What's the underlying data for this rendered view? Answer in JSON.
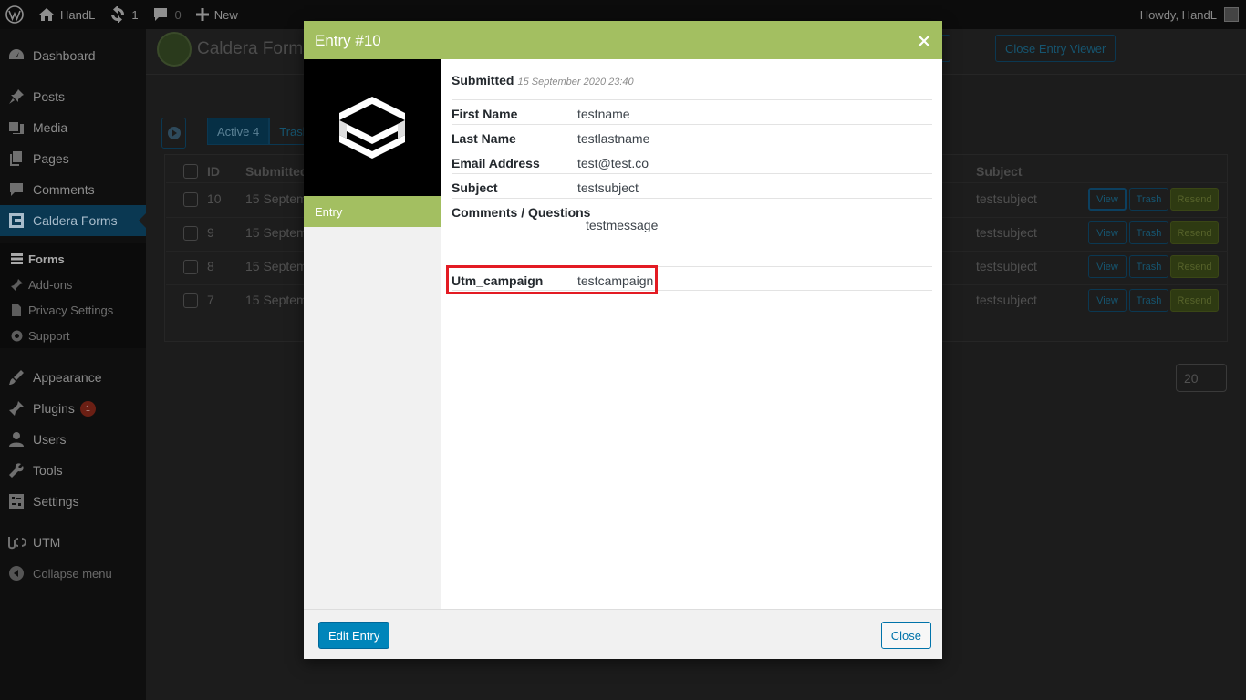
{
  "adminbar": {
    "site_name": "HandL",
    "updates_count": "1",
    "comments_count": "0",
    "new_label": "New",
    "howdy": "Howdy, HandL"
  },
  "sidebar": {
    "items": [
      {
        "label": "Dashboard",
        "icon": "dashboard-icon"
      },
      {
        "label": "Posts",
        "icon": "pin-icon"
      },
      {
        "label": "Media",
        "icon": "media-icon"
      },
      {
        "label": "Pages",
        "icon": "pages-icon"
      },
      {
        "label": "Comments",
        "icon": "comment-icon"
      },
      {
        "label": "Caldera Forms",
        "icon": "caldera-icon"
      },
      {
        "label": "Appearance",
        "icon": "brush-icon"
      },
      {
        "label": "Plugins",
        "icon": "plugin-icon",
        "badge": "1"
      },
      {
        "label": "Users",
        "icon": "user-icon"
      },
      {
        "label": "Tools",
        "icon": "wrench-icon"
      },
      {
        "label": "Settings",
        "icon": "settings-icon"
      },
      {
        "label": "UTM",
        "icon": "utm-icon"
      },
      {
        "label": "Collapse menu",
        "icon": "collapse-icon"
      }
    ],
    "submenu": [
      {
        "label": "Forms"
      },
      {
        "label": "Add-ons"
      },
      {
        "label": "Privacy Settings"
      },
      {
        "label": "Support"
      }
    ]
  },
  "background": {
    "title": "Caldera Forms",
    "close_viewer": "Close Entry Viewer",
    "tab_active": "Active 4",
    "tab_trash": "Trash",
    "col_id": "ID",
    "col_submitted": "Submitted",
    "col_subject": "Subject",
    "rows": [
      {
        "id": "10",
        "submitted": "15 Septem",
        "subject": "testsubject"
      },
      {
        "id": "9",
        "submitted": "15 Septem",
        "subject": "testsubject"
      },
      {
        "id": "8",
        "submitted": "15 Septem",
        "subject": "testsubject"
      },
      {
        "id": "7",
        "submitted": "15 Septem",
        "subject": "testsubject"
      }
    ],
    "btn_view": "View",
    "btn_trash": "Trash",
    "btn_resend": "Resend",
    "per_page": "20"
  },
  "modal": {
    "title": "Entry #10",
    "tab_label": "Entry",
    "submitted_label": "Submitted",
    "submitted_date": "15 September 2020 23:40",
    "fields": [
      {
        "label": "First Name",
        "value": "testname"
      },
      {
        "label": "Last Name",
        "value": "testlastname"
      },
      {
        "label": "Email Address",
        "value": "test@test.co"
      },
      {
        "label": "Subject",
        "value": "testsubject"
      },
      {
        "label": "Comments / Questions",
        "value": "testmessage"
      },
      {
        "label": "Utm_campaign",
        "value": "testcampaign"
      }
    ],
    "edit_button": "Edit Entry",
    "close_button": "Close",
    "accent_color": "#a3bf61",
    "highlight_color": "#e31b23"
  }
}
